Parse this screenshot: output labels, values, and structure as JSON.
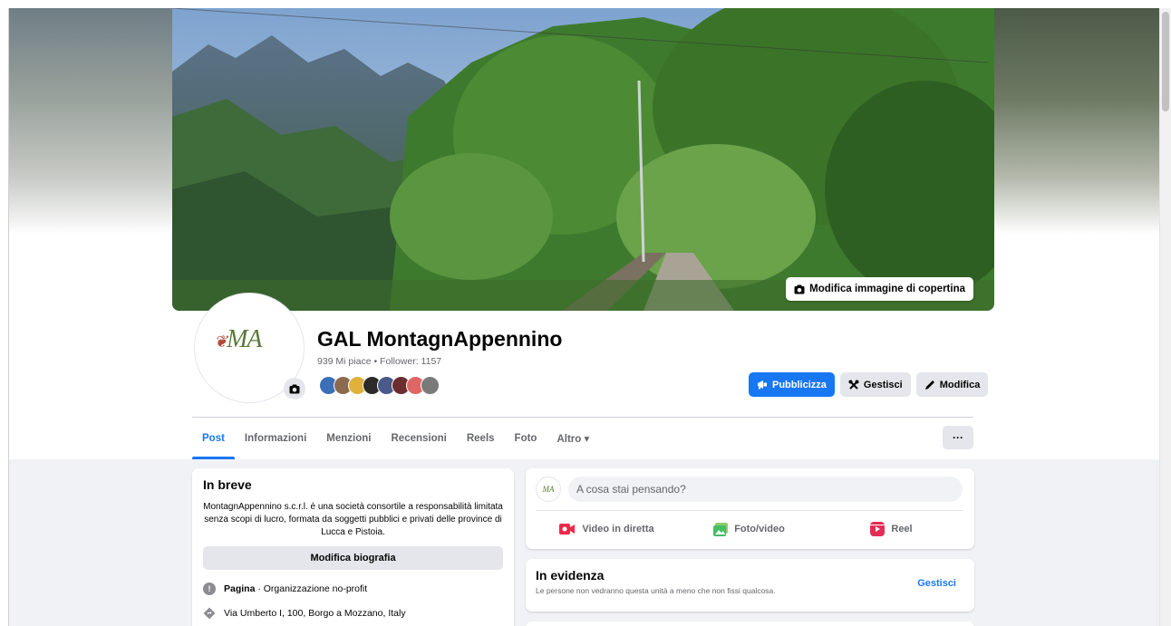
{
  "cover": {
    "edit_label": "Modifica immagine di copertina"
  },
  "profile": {
    "name": "GAL MontagnAppennino",
    "stats": "939 Mi piace • Follower: 1157",
    "logo_text": "MA",
    "follower_avatar_colors": [
      "#3b6fb6",
      "#8c6a4f",
      "#e0b23c",
      "#2b2b2b",
      "#4a5a8a",
      "#6b2d2d",
      "#e06666",
      "#7a7a7a"
    ]
  },
  "actions": {
    "promote": "Pubblicizza",
    "manage": "Gestisci",
    "edit": "Modifica"
  },
  "tabs": [
    {
      "label": "Post"
    },
    {
      "label": "Informazioni"
    },
    {
      "label": "Menzioni"
    },
    {
      "label": "Recensioni"
    },
    {
      "label": "Reels"
    },
    {
      "label": "Foto"
    },
    {
      "label": "Altro ▾"
    }
  ],
  "more_label": "···",
  "intro": {
    "title": "In breve",
    "bio": "MontagnAppennino s.c.r.l. è una società consortile a responsabilità limitata senza scopi di lucro, formata da soggetti pubblici e privati delle province di Lucca e Pistoia.",
    "edit_bio": "Modifica biografia",
    "page_label": "Pagina",
    "page_category": " · Organizzazione no-profit",
    "address": "Via Umberto I, 100, Borgo a Mozzano, Italy"
  },
  "composer": {
    "avatar_text": "MA",
    "placeholder": "A cosa stai pensando?",
    "live": "Video in diretta",
    "photo": "Foto/video",
    "reel": "Reel"
  },
  "featured": {
    "title": "In evidenza",
    "subtitle": "Le persone non vedranno questa unità a meno che non fissi qualcosa.",
    "manage": "Gestisci"
  },
  "colors": {
    "accent": "#1877f2",
    "bg": "#f0f2f5",
    "button_grey": "#e4e6eb"
  }
}
